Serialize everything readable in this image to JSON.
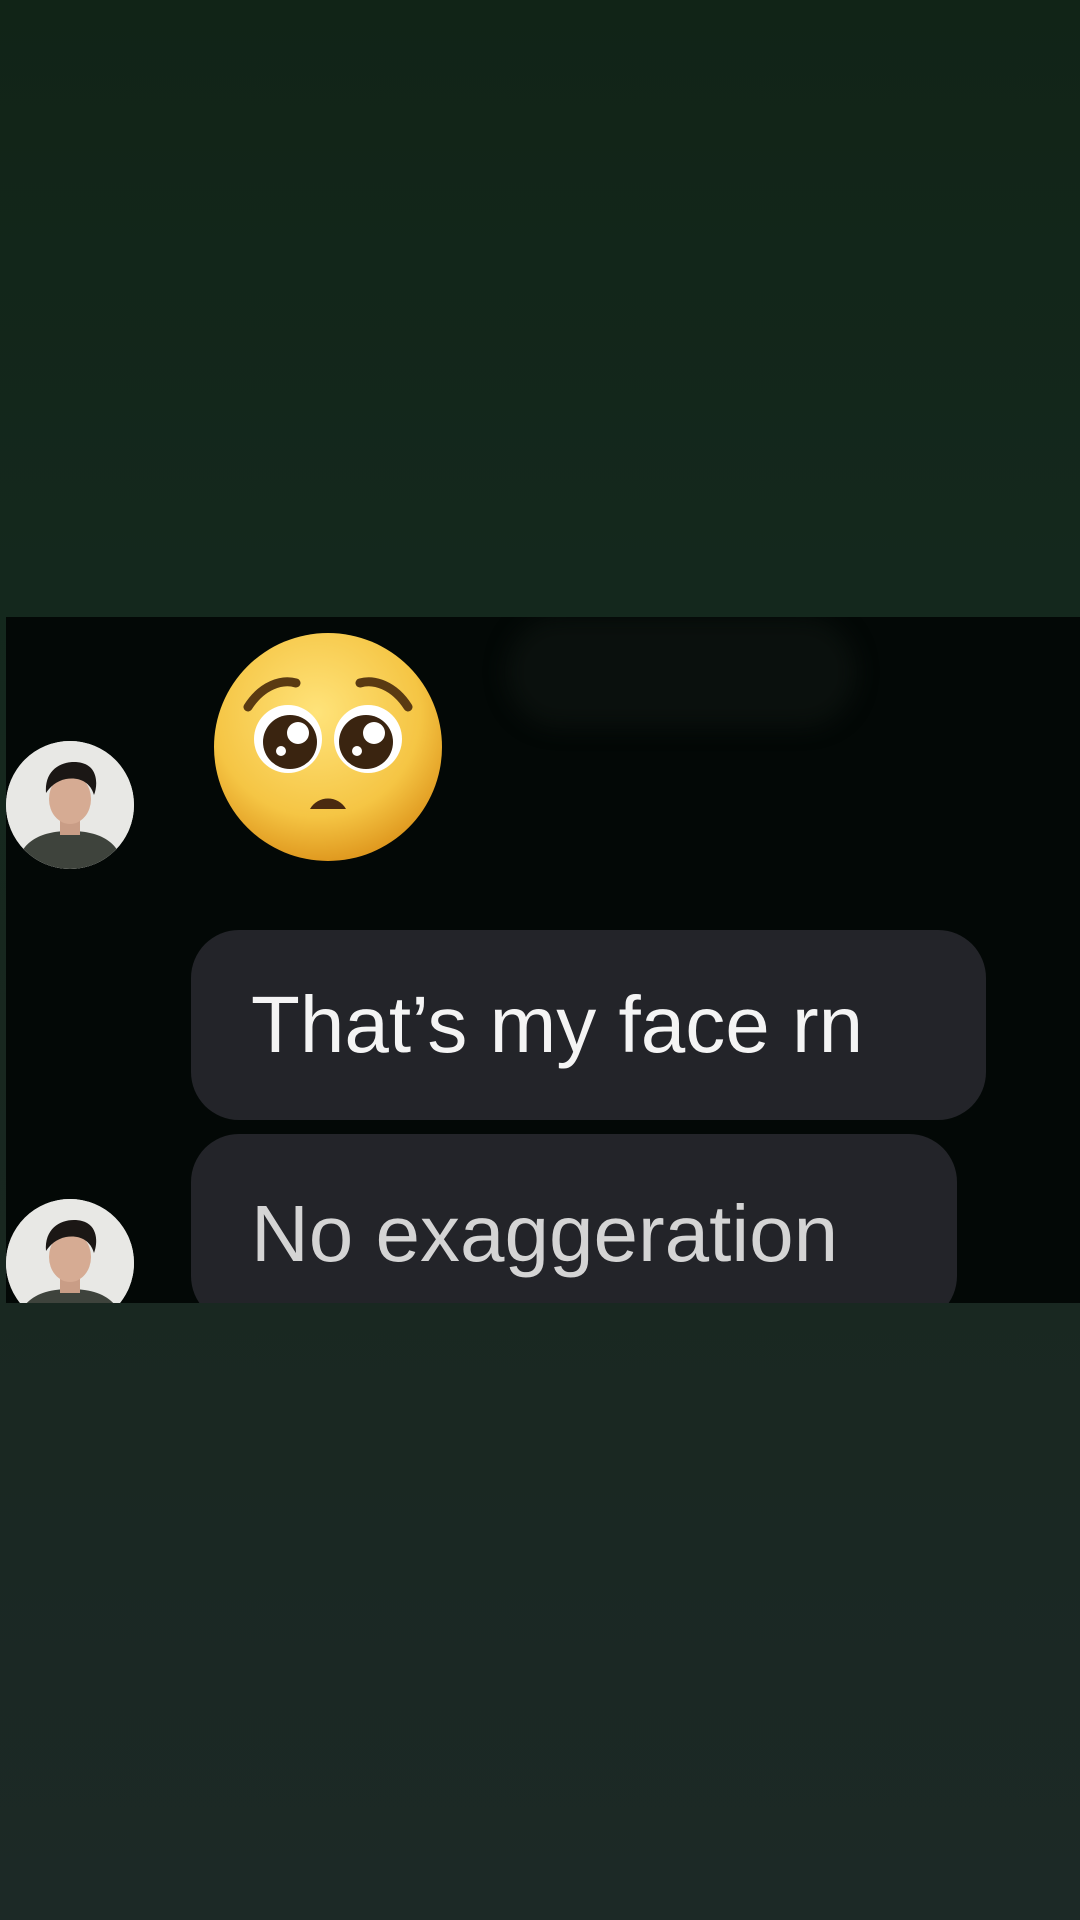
{
  "conversation": {
    "messages": [
      {
        "type": "emoji",
        "icon": "pleading-face-emoji"
      },
      {
        "type": "text",
        "text": "That’s my face rn"
      },
      {
        "type": "text",
        "text": "No exaggeration"
      }
    ]
  },
  "colors": {
    "top_background": "#112417",
    "bottom_background": "#1c2926",
    "chat_background": "#030806",
    "bubble": "#232429",
    "text": "#f4f4f4",
    "emoji_face": "#f5c544"
  }
}
